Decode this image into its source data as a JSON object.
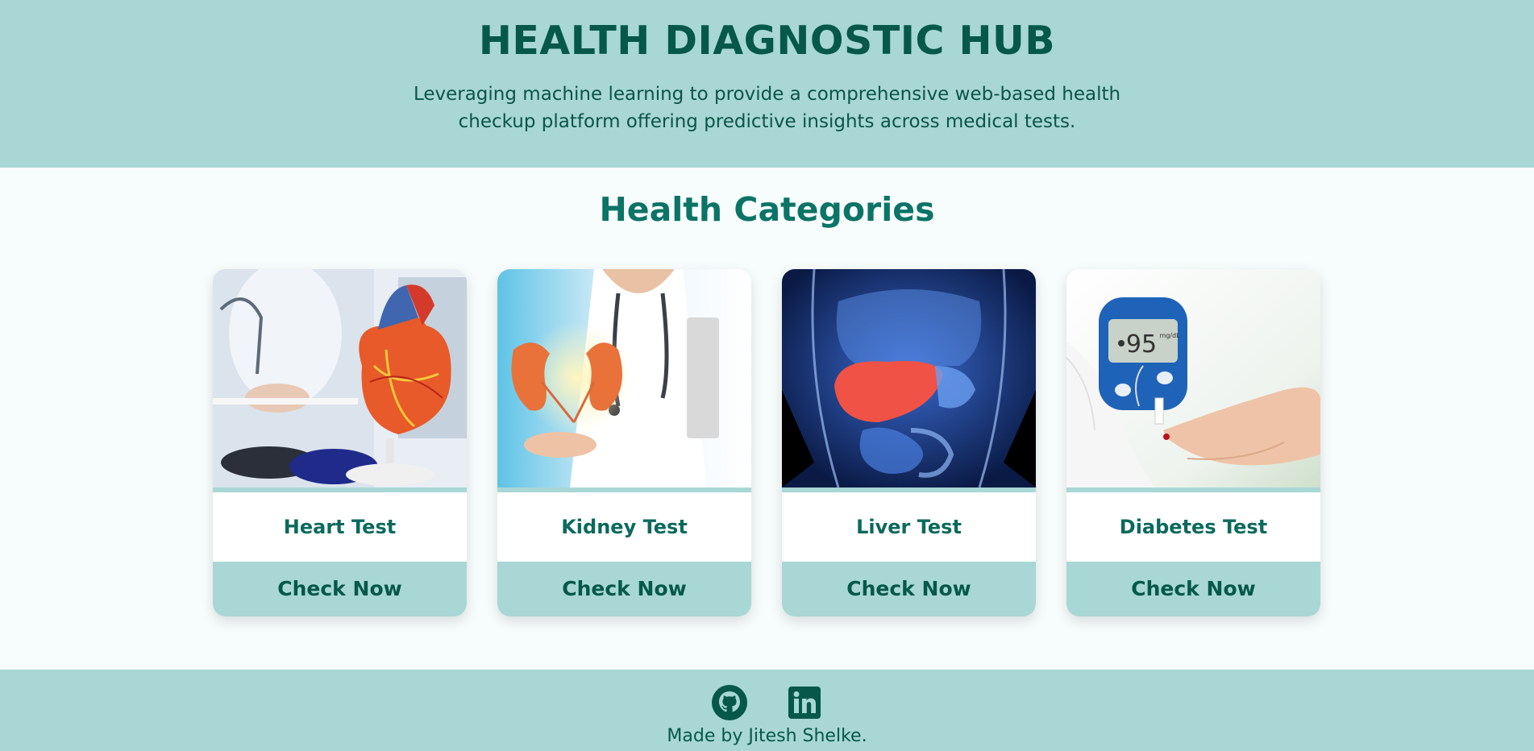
{
  "header": {
    "title": "HEALTH DIAGNOSTIC HUB",
    "subtitle": "Leveraging machine learning to provide a comprehensive web-based health checkup platform offering predictive insights across medical tests."
  },
  "main": {
    "section_title": "Health Categories",
    "cards": [
      {
        "title": "Heart Test",
        "button": "Check Now",
        "image": "heart-anatomy-model"
      },
      {
        "title": "Kidney Test",
        "button": "Check Now",
        "image": "doctor-holding-kidneys"
      },
      {
        "title": "Liver Test",
        "button": "Check Now",
        "image": "xray-liver-torso"
      },
      {
        "title": "Diabetes Test",
        "button": "Check Now",
        "image": "glucose-meter-finger-test",
        "meter_reading": "95",
        "meter_unit": "mg/dL"
      }
    ]
  },
  "footer": {
    "icons": [
      "github-icon",
      "linkedin-icon"
    ],
    "credit": "Made by Jitesh Shelke."
  },
  "colors": {
    "header_bg": "#a8d7d5",
    "title_dark": "#05584a",
    "section_title": "#0b7466",
    "page_bg": "#f7fcfc"
  }
}
